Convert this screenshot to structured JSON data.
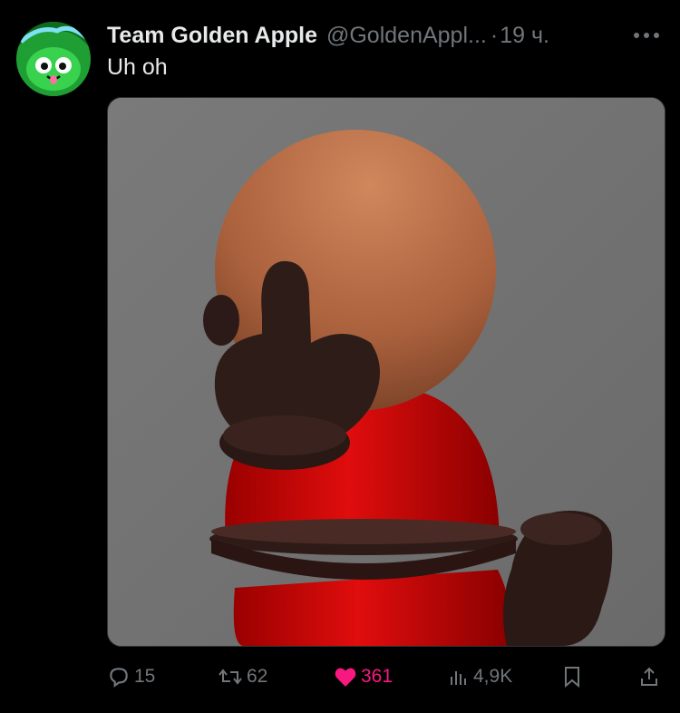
{
  "tweet": {
    "author_name": "Team Golden Apple",
    "handle": "@GoldenAppl...",
    "separator": "·",
    "time": "19 ч.",
    "text": "Uh oh"
  },
  "actions": {
    "replies": "15",
    "reposts": "62",
    "likes": "361",
    "views": "4,9K"
  },
  "icons": {
    "more": "more-horizontal-icon",
    "reply": "speech-bubble-icon",
    "repost": "repost-arrows-icon",
    "like": "heart-filled-icon",
    "views": "bar-chart-icon",
    "bookmark": "bookmark-icon",
    "share": "share-upload-icon"
  },
  "colors": {
    "background": "#000000",
    "text": "#e7e9ea",
    "muted": "#71767b",
    "like": "#f91880"
  }
}
